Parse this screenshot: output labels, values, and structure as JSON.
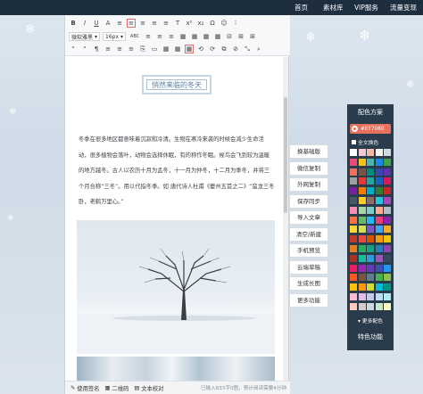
{
  "nav": [
    "首页",
    "素材库",
    "VIP服务",
    "流量变现"
  ],
  "toolbar": {
    "row1": [
      "B",
      "I",
      "U",
      "A",
      "≡",
      "≡",
      "≡",
      "≡",
      "≡",
      "T",
      "x²",
      "x₂",
      "Ω",
      "☺",
      "⁝"
    ],
    "font_family": "微软雅黑",
    "font_size": "16px",
    "row2_rest": [
      "ABC",
      "≡",
      "≡",
      "≡",
      "▦",
      "▦",
      "▦",
      "▦",
      "⊟",
      "⊞",
      "⊞"
    ],
    "row3": [
      "“",
      "“",
      "¶",
      "≡",
      "≡",
      "≡",
      "⎘",
      "▭",
      "▦",
      "▦",
      "▦",
      "⟲",
      "⟳",
      "⧉",
      "⊘",
      "⤡",
      "⌕"
    ]
  },
  "article": {
    "title": "悄然来临的冬天",
    "paragraph": "冬季在很多地区都意味着沉寂和冷清。生物在寒冷来袭的时候会减少生命活动，很多植物会落叶，动物会选择休眠，有的称作冬眠。候鸟会飞到较为温暖的地方越冬。古人以农历十月为孟冬，十一月为仲冬，十二月为季冬，并将三个月合称“三冬”。用以代指冬季。如 唐代诗人杜甫《夔州五首之二》“蛮龙三冬卧，老鹤万里心。”"
  },
  "statusbar": {
    "signature": "使用签名",
    "qrcode": "二维码",
    "proofread": "文本校对",
    "stats": "已输入833字0图，预计阅读需要4分钟"
  },
  "functions": [
    "换基础版",
    "微信复制",
    "外网复制",
    "保存同步",
    "导入文章",
    "清空/新建",
    "手机预览",
    "云端草稿",
    "生成长图",
    "更多功能"
  ],
  "color_panel": {
    "title": "配色方案",
    "current_hex": "#EF7060",
    "all_label": "全文换色",
    "more_label": "▾ 更多配色",
    "func_label": "特色功能",
    "swatches": [
      [
        "#ffffff",
        "#f6c7d5",
        "#f7b7a3",
        "#f2f2f2",
        "#cfd8dc"
      ],
      [
        "#e94b7b",
        "#f0c419",
        "#4db6ac",
        "#1e88e5",
        "#43a047"
      ],
      [
        "#ef7060",
        "#795548",
        "#00897b",
        "#3949ab",
        "#5e35b1"
      ],
      [
        "#9e9e9e",
        "#e53935",
        "#26a69a",
        "#1565c0",
        "#d81b60"
      ],
      [
        "#7b1fa2",
        "#f57c00",
        "#00acc1",
        "#2e7d32",
        "#c62828"
      ],
      [
        "#455a64",
        "#ffca28",
        "#8d6e63",
        "#26c6da",
        "#ab47bc"
      ],
      [
        "#f48fb1",
        "#a5d6a7",
        "#80cbc4",
        "#ffab91",
        "#b0bec5"
      ],
      [
        "#ff7043",
        "#66bb6a",
        "#29b6f6",
        "#ec407a",
        "#8e24aa"
      ],
      [
        "#fdd835",
        "#d4e157",
        "#7e57c2",
        "#42a5f5",
        "#ffa726"
      ],
      [
        "#c0392b",
        "#e74c3c",
        "#d35400",
        "#f39c12",
        "#f1c40f"
      ],
      [
        "#e67e22",
        "#27ae60",
        "#16a085",
        "#2980b9",
        "#8e44ad"
      ],
      [
        "#a93226",
        "#1abc9c",
        "#3498db",
        "#9b59b6",
        "#34495e"
      ],
      [
        "#e91e63",
        "#9c27b0",
        "#673ab7",
        "#3f51b5",
        "#2196f3"
      ],
      [
        "#ff5722",
        "#795548",
        "#607d8b",
        "#4caf50",
        "#8bc34a"
      ],
      [
        "#ffc107",
        "#ff9800",
        "#cddc39",
        "#00bcd4",
        "#009688"
      ],
      [
        "#f8bbd0",
        "#e1bee7",
        "#c5cae9",
        "#bbdefb",
        "#b2ebf2"
      ],
      [
        "#ffccbc",
        "#d7ccc8",
        "#cfd8dc",
        "#c8e6c9",
        "#fff9c4"
      ]
    ]
  }
}
